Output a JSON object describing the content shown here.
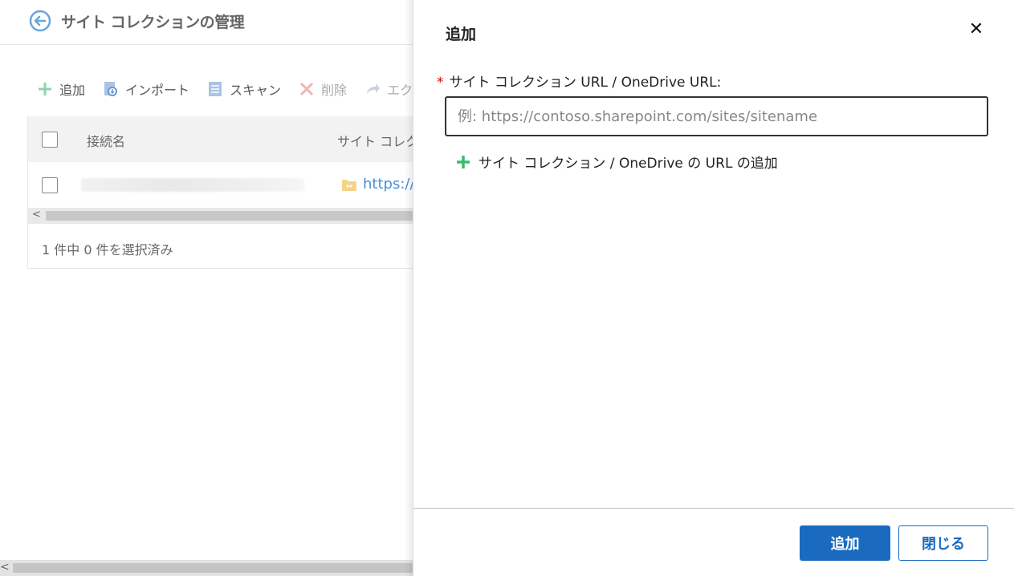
{
  "page": {
    "title": "サイト コレクションの管理"
  },
  "toolbar": {
    "add_label": "追加",
    "import_label": "インポート",
    "scan_label": "スキャン",
    "delete_label": "削除",
    "export_label": "エクス"
  },
  "grid": {
    "columns": [
      "接続名",
      "サイト コレクシ"
    ],
    "rows": [
      {
        "name": "",
        "url": "https://"
      }
    ],
    "footer": "1 件中 0 件を選択済み"
  },
  "panel": {
    "title": "追加",
    "field_label": "サイト コレクション URL / OneDrive URL:",
    "required_mark": "*",
    "input_value": "",
    "input_placeholder": "例: https://contoso.sharepoint.com/sites/sitename",
    "add_url_label": "サイト コレクション / OneDrive の URL の追加",
    "submit_label": "追加",
    "close_label": "閉じる"
  },
  "colors": {
    "primary": "#1a6bbf",
    "add_green": "#3dbb6b",
    "link": "#4a90d9",
    "required": "#d40000"
  },
  "icons": {
    "back": "back-arrow-icon",
    "add": "plus-icon",
    "import": "import-icon",
    "scan": "scan-icon",
    "delete": "delete-icon",
    "export": "export-icon",
    "close": "close-icon",
    "folder": "folder-icon"
  }
}
